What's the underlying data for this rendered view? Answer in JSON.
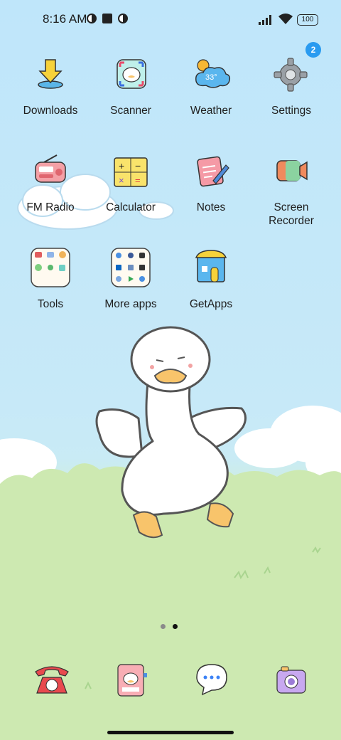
{
  "status_bar": {
    "time": "8:16 AM",
    "battery": "100",
    "icons": [
      "notification-c-icon",
      "square-notification-icon",
      "notification-c-icon",
      "signal-icon",
      "wifi-icon",
      "battery-icon"
    ]
  },
  "apps": [
    {
      "label": "Downloads",
      "icon": "download-arrow-icon"
    },
    {
      "label": "Scanner",
      "icon": "duck-scanner-icon"
    },
    {
      "label": "Weather",
      "icon": "weather-cloud-icon",
      "icon_text": "33°"
    },
    {
      "label": "Settings",
      "icon": "gear-icon",
      "badge": "2"
    },
    {
      "label": "FM Radio",
      "icon": "radio-icon"
    },
    {
      "label": "Calculator",
      "icon": "calculator-icon"
    },
    {
      "label": "Notes",
      "icon": "notepad-icon"
    },
    {
      "label_line1": "Screen",
      "label_line2": "Recorder",
      "icon": "video-camera-icon"
    },
    {
      "label": "Tools",
      "icon": "folder-icon"
    },
    {
      "label": "More apps",
      "icon": "folder-icon"
    },
    {
      "label": "GetApps",
      "icon": "store-icon"
    }
  ],
  "page_indicator": {
    "pages": 2,
    "current": 2
  },
  "dock": [
    {
      "name": "phone",
      "icon": "telephone-icon"
    },
    {
      "name": "contacts",
      "icon": "contacts-book-icon"
    },
    {
      "name": "messages",
      "icon": "chat-bubble-icon"
    },
    {
      "name": "camera",
      "icon": "camera-icon"
    }
  ],
  "colors": {
    "sky": "#bfe6fa",
    "grass": "#cdebb7",
    "badge": "#2a9bf0",
    "text": "#1e1e1e"
  }
}
